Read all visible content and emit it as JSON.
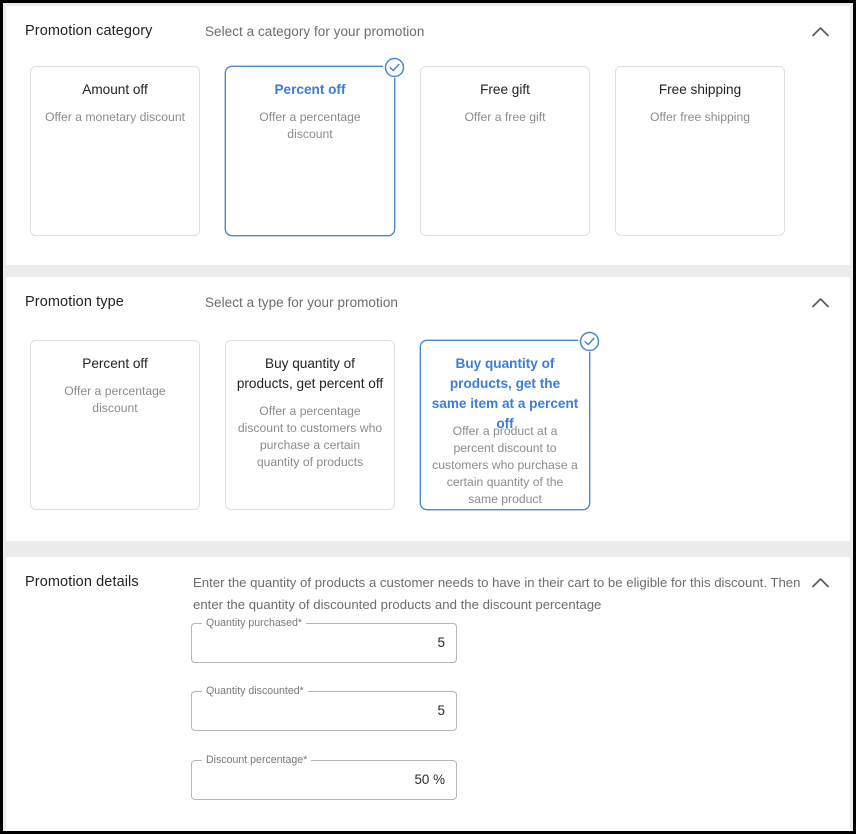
{
  "sections": [
    {
      "title": "Promotion category",
      "subtitle": "Select a category for your promotion",
      "collapse_icon": "chevron-up-icon",
      "options": [
        {
          "title": "Amount off",
          "desc": "Offer a monetary discount",
          "selected": false
        },
        {
          "title": "Percent off",
          "desc": "Offer a percentage discount",
          "selected": true
        },
        {
          "title": "Free gift",
          "desc": "Offer a free gift",
          "selected": false
        },
        {
          "title": "Free shipping",
          "desc": "Offer free shipping",
          "selected": false
        }
      ]
    },
    {
      "title": "Promotion type",
      "subtitle": "Select a type for your promotion",
      "collapse_icon": "chevron-up-icon",
      "options": [
        {
          "title": "Percent off",
          "desc": "Offer a percentage discount",
          "selected": false
        },
        {
          "title": "Buy quantity of products, get percent off",
          "desc": "Offer a percentage discount to customers who purchase a certain quantity of products",
          "selected": false
        },
        {
          "title": "Buy quantity of products, get the same item at a percent off",
          "desc": "Offer a product at a percent discount to customers who purchase a certain quantity of the same product",
          "selected": true
        }
      ]
    }
  ],
  "details": {
    "title": "Promotion details",
    "description": "Enter the quantity of products a customer needs to have in their cart to be eligible for this discount. Then enter the quantity of discounted products and the discount percentage",
    "collapse_icon": "chevron-up-icon",
    "fields": [
      {
        "label": "Quantity purchased*",
        "value": "5"
      },
      {
        "label": "Quantity discounted*",
        "value": "5"
      },
      {
        "label": "Discount percentage*",
        "value": "50 %"
      }
    ]
  },
  "colors": {
    "accent": "#3b7dd8",
    "selected_border": "#4e87c7",
    "panel_bg": "#ffffff",
    "page_bg": "#ececec",
    "card_border": "#e0e0e0",
    "muted_text": "#8c8c8c"
  }
}
